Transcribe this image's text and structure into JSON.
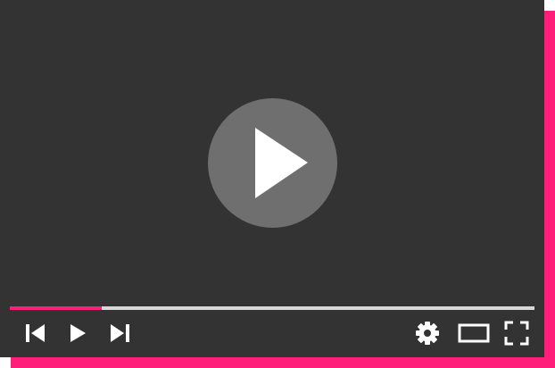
{
  "player": {
    "state": "paused",
    "progress_fraction": 0.175,
    "colors": {
      "accent": "#ff1f7a",
      "screen": "#333333",
      "big_button": "#6f6f6f",
      "track": "#d8d8d8",
      "icon": "#ffffff"
    },
    "controls_left": [
      "skip-previous-icon",
      "play-icon",
      "skip-next-icon"
    ],
    "controls_right": [
      "gear-icon",
      "theater-mode-icon",
      "fullscreen-icon"
    ]
  }
}
